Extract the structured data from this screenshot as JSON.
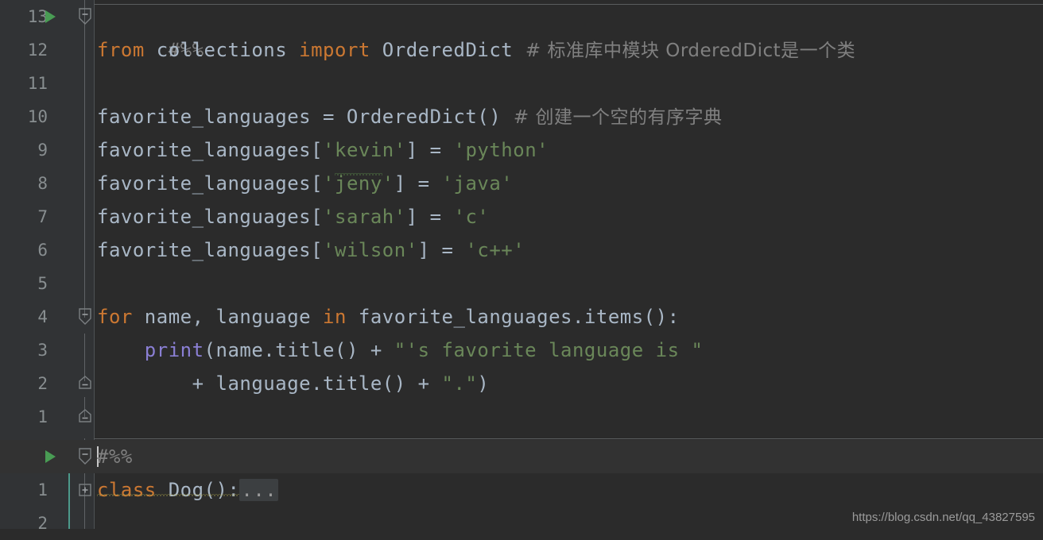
{
  "app": {
    "kind": "python-code-editor",
    "theme": "darcula",
    "colors": {
      "editor_background": "#2b2b2b",
      "gutter_background": "#313335",
      "current_line_background": "#323232",
      "keyword": "#cc7832",
      "identifier": "#a9b7c6",
      "string": "#6a8759",
      "comment": "#808080",
      "function": "#8a7fd4",
      "line_number": "#888e90",
      "run_arrow": "#499c54",
      "cell_bar": "#4c9a8b",
      "fold_marker": "#606366",
      "spellcheck_squiggle": "#5b8a4a",
      "warning_squiggle": "#a9a14a"
    }
  },
  "gutter": {
    "line_numbers": [
      "13",
      "12",
      "11",
      "10",
      "9",
      "8",
      "7",
      "6",
      "5",
      "4",
      "3",
      "2",
      "1",
      "",
      "1",
      "2"
    ],
    "run_arrow_rows": [
      0,
      13
    ],
    "fold_minus_rows": [
      0,
      9,
      11,
      12,
      13
    ],
    "fold_plus_rows": [
      14
    ]
  },
  "code": {
    "lines": [
      {
        "row": 0,
        "number": "13",
        "text": "#%%",
        "tokens": [
          {
            "t": "#%%",
            "c": "cmt"
          }
        ],
        "fold": "minus-open",
        "run_arrow": true
      },
      {
        "row": 1,
        "number": "12",
        "text": "from collections import OrderedDict  # 标准库中模块 OrderedDict是一个类",
        "tokens": [
          {
            "t": "from",
            "c": "kw"
          },
          {
            "t": " collections ",
            "c": "id"
          },
          {
            "t": "import",
            "c": "kw"
          },
          {
            "t": " OrderedDict",
            "c": "id"
          },
          {
            "t": "  # 标准库中模块 OrderedDict是一个类",
            "c": "cmt"
          }
        ]
      },
      {
        "row": 2,
        "number": "11",
        "text": "",
        "tokens": []
      },
      {
        "row": 3,
        "number": "10",
        "text": "favorite_languages = OrderedDict()  # 创建一个空的有序字典",
        "tokens": [
          {
            "t": "favorite_languages = OrderedDict()",
            "c": "id"
          },
          {
            "t": "  # 创建一个空的有序字典",
            "c": "cmt"
          }
        ]
      },
      {
        "row": 4,
        "number": "9",
        "text": "favorite_languages['kevin'] = 'python'",
        "tokens": [
          {
            "t": "favorite_languages[",
            "c": "id"
          },
          {
            "t": "'kevin'",
            "c": "str"
          },
          {
            "t": "] = ",
            "c": "id"
          },
          {
            "t": "'python'",
            "c": "str"
          }
        ]
      },
      {
        "row": 5,
        "number": "8",
        "text": "favorite_languages['jeny'] = 'java'",
        "tokens": [
          {
            "t": "favorite_languages[",
            "c": "id"
          },
          {
            "t": "'",
            "c": "str"
          },
          {
            "t": "jeny",
            "c": "str-squiggle"
          },
          {
            "t": "'",
            "c": "str"
          },
          {
            "t": "] = ",
            "c": "id"
          },
          {
            "t": "'java'",
            "c": "str"
          }
        ]
      },
      {
        "row": 6,
        "number": "7",
        "text": "favorite_languages['sarah'] = 'c'",
        "tokens": [
          {
            "t": "favorite_languages[",
            "c": "id"
          },
          {
            "t": "'sarah'",
            "c": "str"
          },
          {
            "t": "] = ",
            "c": "id"
          },
          {
            "t": "'c'",
            "c": "str"
          }
        ]
      },
      {
        "row": 7,
        "number": "6",
        "text": "favorite_languages['wilson'] = 'c++'",
        "tokens": [
          {
            "t": "favorite_languages[",
            "c": "id"
          },
          {
            "t": "'wilson'",
            "c": "str"
          },
          {
            "t": "] = ",
            "c": "id"
          },
          {
            "t": "'c++'",
            "c": "str"
          }
        ]
      },
      {
        "row": 8,
        "number": "5",
        "text": "",
        "tokens": []
      },
      {
        "row": 9,
        "number": "4",
        "text": "for name, language in favorite_languages.items():",
        "tokens": [
          {
            "t": "for",
            "c": "kw"
          },
          {
            "t": " name, language ",
            "c": "id"
          },
          {
            "t": "in",
            "c": "kw"
          },
          {
            "t": " favorite_languages.items():",
            "c": "id"
          }
        ],
        "fold": "minus-open"
      },
      {
        "row": 10,
        "number": "3",
        "text": "    print(name.title() + \"'s favorite language is \"",
        "tokens": [
          {
            "t": "    ",
            "c": "id"
          },
          {
            "t": "print",
            "c": "fn"
          },
          {
            "t": "(name.title() + ",
            "c": "id"
          },
          {
            "t": "\"'s favorite language is \"",
            "c": "str"
          }
        ]
      },
      {
        "row": 11,
        "number": "2",
        "text": "        + language.title() + \".\")",
        "tokens": [
          {
            "t": "        + language.title() + ",
            "c": "id"
          },
          {
            "t": "\".\"",
            "c": "str"
          },
          {
            "t": ")",
            "c": "id"
          }
        ],
        "fold": "minus-end"
      },
      {
        "row": 12,
        "number": "1",
        "text": "",
        "tokens": [],
        "fold": "minus-end"
      },
      {
        "row": 13,
        "number": "",
        "text": "#%%",
        "tokens": [
          {
            "t": "#%%",
            "c": "cmt"
          }
        ],
        "fold": "minus-open",
        "run_arrow": true,
        "current_line": true,
        "caret": true
      },
      {
        "row": 14,
        "number": "1",
        "text": "class Dog():...",
        "tokens": [
          {
            "t": "class",
            "c": "kw"
          },
          {
            "t": " Dog():",
            "c": "id"
          },
          {
            "t": "...",
            "c": "folded"
          }
        ],
        "fold": "plus-collapsed",
        "warning_squiggle": true
      },
      {
        "row": 15,
        "number": "2",
        "text": "",
        "tokens": []
      }
    ]
  },
  "watermark": {
    "text": "https://blog.csdn.net/qq_43827595"
  }
}
